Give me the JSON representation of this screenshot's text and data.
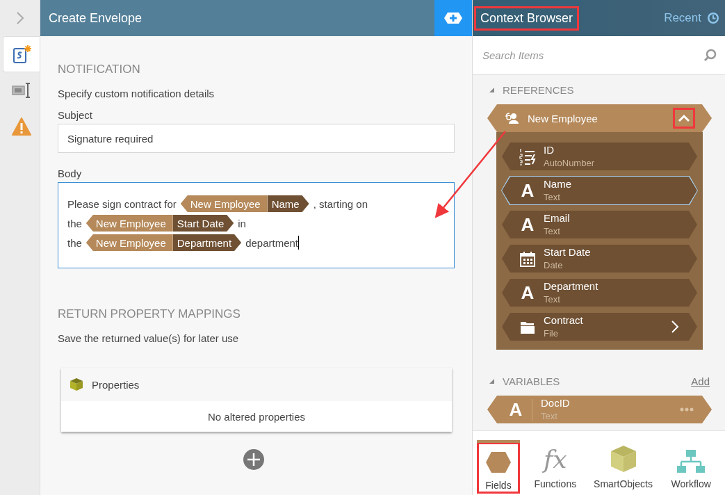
{
  "rail": {
    "items": [
      {
        "kind": "script",
        "selected": true
      },
      {
        "kind": "form-field",
        "selected": false
      },
      {
        "kind": "warning",
        "selected": false
      }
    ]
  },
  "editor": {
    "title": "Create Envelope",
    "notification": {
      "heading": "NOTIFICATION",
      "description": "Specify custom notification details",
      "subject_label": "Subject",
      "subject_value": "Signature required",
      "body_label": "Body",
      "cursor": true,
      "body_lines": [
        [
          {
            "kind": "text",
            "text": "Please sign contract for"
          },
          {
            "kind": "token",
            "source": "New Employee",
            "field": "Name"
          },
          {
            "kind": "text",
            "text": ", starting on"
          }
        ],
        [
          {
            "kind": "text",
            "text": "the"
          },
          {
            "kind": "token",
            "source": "New Employee",
            "field": "Start Date"
          },
          {
            "kind": "text",
            "text": "in"
          }
        ],
        [
          {
            "kind": "text",
            "text": "the"
          },
          {
            "kind": "token",
            "source": "New Employee",
            "field": "Department"
          },
          {
            "kind": "text",
            "text": "department"
          }
        ]
      ]
    },
    "return_mappings": {
      "heading": "RETURN PROPERTY MAPPINGS",
      "description": "Save the returned value(s) for later use",
      "card_title": "Properties",
      "empty_text": "No altered properties"
    }
  },
  "context_browser": {
    "title": "Context Browser",
    "title_highlighted": true,
    "recent": "Recent",
    "search_placeholder": "Search Items",
    "references": {
      "heading": "REFERENCES",
      "expanded": true,
      "items": [
        {
          "name": "New Employee",
          "expanded": true,
          "toggle_highlighted": true,
          "fields": [
            {
              "kind": "number",
              "name": "ID",
              "type": "AutoNumber",
              "selected": false
            },
            {
              "kind": "text",
              "icon_glyph": "A",
              "name": "Name",
              "type": "Text",
              "selected": true
            },
            {
              "kind": "text",
              "icon_glyph": "A",
              "name": "Email",
              "type": "Text",
              "selected": false
            },
            {
              "kind": "date",
              "name": "Start Date",
              "type": "Date",
              "selected": false
            },
            {
              "kind": "text",
              "icon_glyph": "A",
              "name": "Department",
              "type": "Text",
              "selected": false
            },
            {
              "kind": "file",
              "name": "Contract",
              "type": "File",
              "selected": false,
              "has_children": true
            }
          ]
        }
      ]
    },
    "variables": {
      "heading": "VARIABLES",
      "expanded": true,
      "add": "Add",
      "items": [
        {
          "kind": "text",
          "icon_glyph": "A",
          "name": "DocID",
          "type": "Text"
        }
      ]
    },
    "tabs": [
      {
        "kind": "fields",
        "label": "Fields",
        "selected": true,
        "highlighted": true
      },
      {
        "kind": "functions",
        "icon_glyph": "fx",
        "label": "Functions",
        "selected": false,
        "highlighted": false
      },
      {
        "kind": "smartobjects",
        "label": "SmartObjects",
        "selected": false,
        "highlighted": false
      },
      {
        "kind": "workflow",
        "label": "Workflow",
        "selected": false,
        "highlighted": false
      }
    ]
  },
  "annotation_arrow": true
}
